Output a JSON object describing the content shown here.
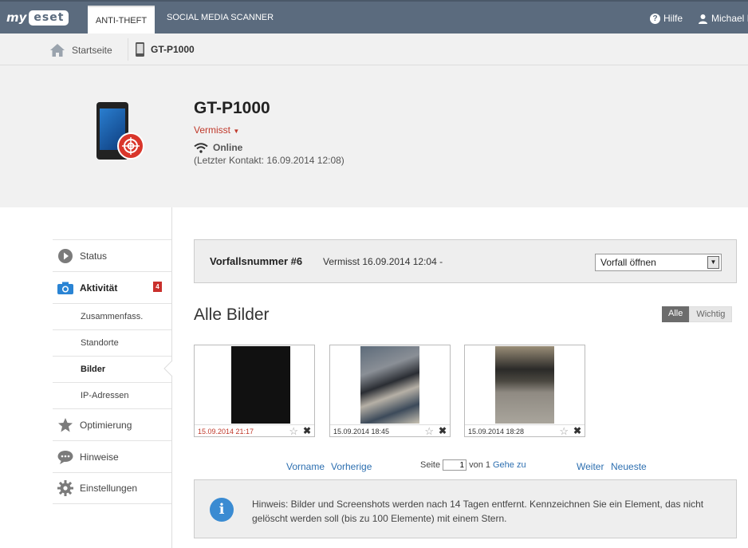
{
  "topbar": {
    "logo_my": "my",
    "logo_eset": "eset",
    "tabs": [
      {
        "label": "ANTI-THEFT",
        "active": true
      },
      {
        "label": "SOCIAL MEDIA SCANNER",
        "active": false
      }
    ],
    "help_label": "Hilfe",
    "user_label": "Michael I"
  },
  "breadcrumb": {
    "home_label": "Startseite",
    "device_label": "GT-P1000"
  },
  "device": {
    "name": "GT-P1000",
    "status": "Vermisst",
    "connection": "Online",
    "last_contact": "(Letzter Kontakt: 16.09.2014 12:08)"
  },
  "sidebar": {
    "items": [
      {
        "label": "Status",
        "icon": "play-circle-icon"
      },
      {
        "label": "Aktivität",
        "icon": "camera-icon",
        "badge": "4",
        "active": true
      },
      {
        "label": "Zusammenfass."
      },
      {
        "label": "Standorte"
      },
      {
        "label": "Bilder",
        "active": true
      },
      {
        "label": "IP-Adressen"
      },
      {
        "label": "Optimierung",
        "icon": "star-icon"
      },
      {
        "label": "Hinweise",
        "icon": "chat-icon"
      },
      {
        "label": "Einstellungen",
        "icon": "gear-icon"
      }
    ]
  },
  "incident": {
    "title": "Vorfallsnummer #6",
    "description": "Vermisst 16.09.2014 12:04 -",
    "select_value": "Vorfall öffnen"
  },
  "gallery": {
    "title": "Alle Bilder",
    "filter_all": "Alle",
    "filter_important": "Wichtig",
    "images": [
      {
        "timestamp": "15.09.2014 21:17",
        "highlight_color": "#c0392b"
      },
      {
        "timestamp": "15.09.2014 18:45"
      },
      {
        "timestamp": "15.09.2014 18:28"
      }
    ]
  },
  "pagination": {
    "first": "Vorname",
    "previous": "Vorherige",
    "page_label": "Seite",
    "page_value": "1",
    "of_label": "von 1",
    "goto": "Gehe zu",
    "next": "Weiter",
    "last": "Neueste"
  },
  "note": {
    "text": "Hinweis: Bilder und Screenshots werden nach 14 Tagen entfernt. Kennzeichnen Sie ein Element, das nicht gelöscht werden soll (bis zu 100 Elemente) mit einem Stern."
  }
}
